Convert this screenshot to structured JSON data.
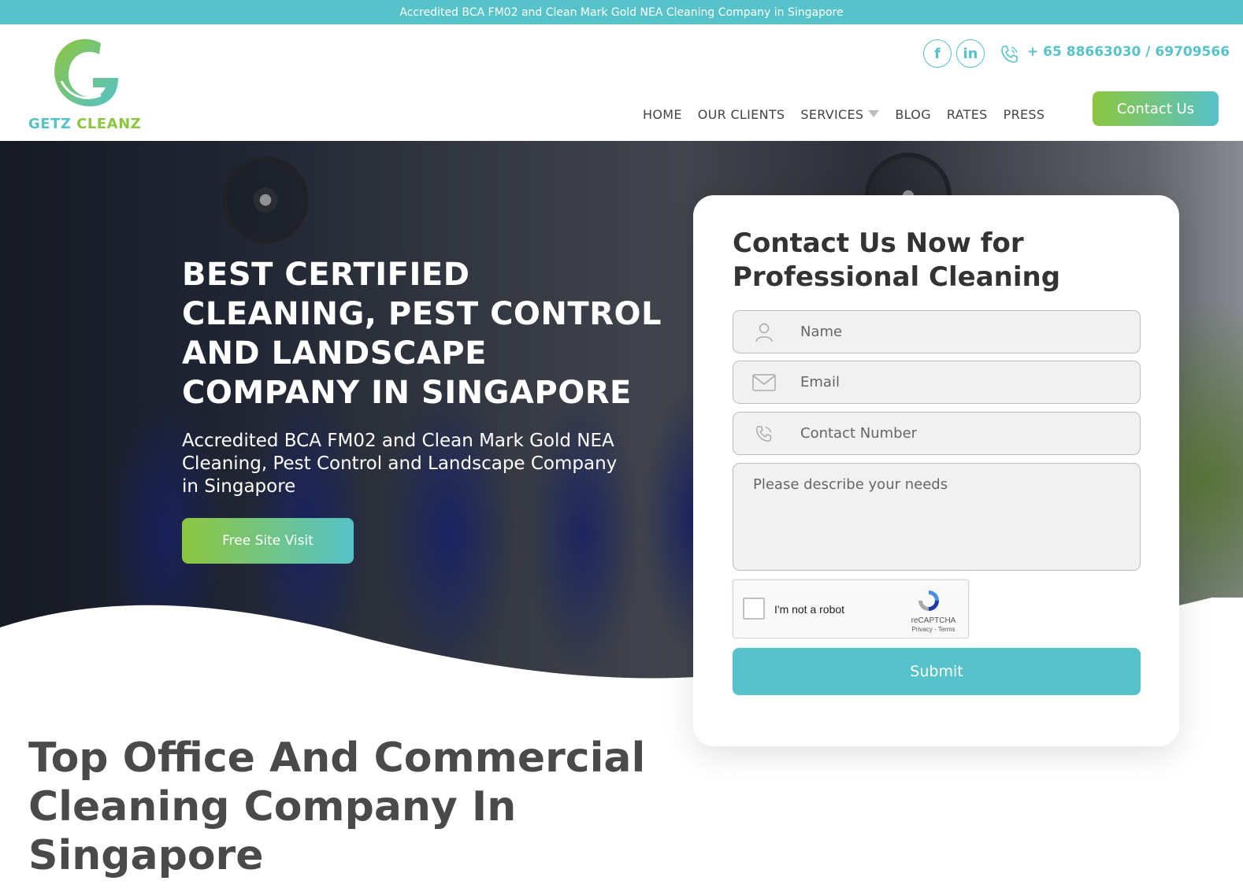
{
  "topbar": {
    "text": "Accredited BCA FM02 and Clean Mark Gold NEA Cleaning Company in Singapore"
  },
  "logo": {
    "word1": "GETZ",
    "word2": "CLEANZ"
  },
  "header": {
    "social": {
      "facebook": "f",
      "linkedin": "in"
    },
    "phone": "+ 65 88663030 / 69709566",
    "nav": [
      "HOME",
      "OUR CLIENTS",
      "SERVICES",
      "BLOG",
      "RATES",
      "PRESS"
    ],
    "contact_button": "Contact Us"
  },
  "hero": {
    "title": "BEST CERTIFIED CLEANING, PEST CONTROL AND LANDSCAPE COMPANY IN SINGAPORE",
    "subtitle": "Accredited BCA FM02 and Clean Mark Gold NEA Cleaning, Pest Control and Landscape Company in Singapore",
    "cta": "Free Site Visit"
  },
  "form": {
    "title": "Contact Us Now for Professional Cleaning",
    "name_placeholder": "Name",
    "email_placeholder": "Email",
    "phone_placeholder": "Contact Number",
    "needs_placeholder": "Please describe your needs",
    "captcha_label": "I'm not a robot",
    "captcha_brand": "reCAPTCHA",
    "captcha_terms": "Privacy - Terms",
    "submit": "Submit"
  },
  "section": {
    "title": "Top Office And Commercial Cleaning Company In Singapore"
  },
  "colors": {
    "teal": "#56c2c9",
    "green": "#8cc63f"
  },
  "icons": [
    "facebook-icon",
    "linkedin-icon",
    "phone-icon",
    "user-icon",
    "mail-icon",
    "recaptcha-icon"
  ]
}
